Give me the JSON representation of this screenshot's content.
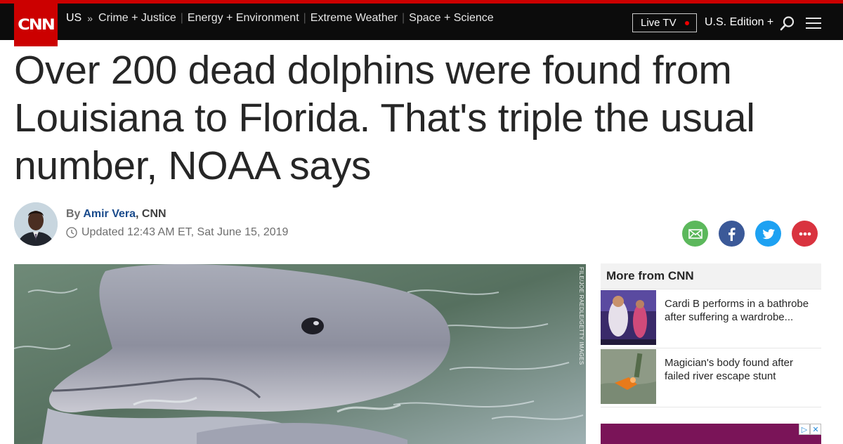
{
  "header": {
    "logo_text": "CNN",
    "section": "US",
    "nav_links": [
      "Crime + Justice",
      "Energy + Environment",
      "Extreme Weather",
      "Space + Science"
    ],
    "live_tv": "Live TV",
    "edition": "U.S. Edition +",
    "brand_color": "#cc0000"
  },
  "article": {
    "headline": "Over 200 dead dolphins were found from Louisiana to Florida. That's triple the usual number, NOAA says",
    "by_prefix": "By",
    "author": "Amir Vera",
    "outlet": ", CNN",
    "updated": "Updated 12:43 AM ET, Sat June 15, 2019",
    "image_credit": "FILE/JOE RAEDLE/GETTY IMAGES"
  },
  "share": {
    "email": "email-icon",
    "facebook": "facebook-icon",
    "twitter": "twitter-icon",
    "more": "more-icon",
    "colors": {
      "email": "#5cb85c",
      "facebook": "#3b5998",
      "twitter": "#1da1f2",
      "more": "#d9333f"
    }
  },
  "sidebar": {
    "title": "More from CNN",
    "stories": [
      {
        "title": "Cardi B performs in a bathrobe after suffering a wardrobe..."
      },
      {
        "title": "Magician's body found after failed river escape stunt"
      }
    ]
  }
}
